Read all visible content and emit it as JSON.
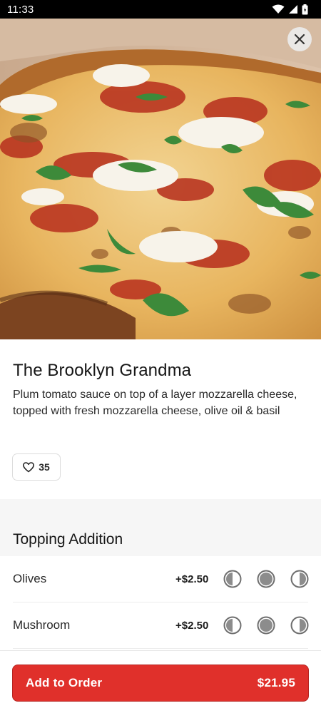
{
  "status_bar": {
    "time": "11:33",
    "icons": [
      "wifi-icon",
      "signal-icon",
      "battery-icon"
    ]
  },
  "hero": {
    "image": "pizza-photo",
    "close_icon": "close-icon"
  },
  "item": {
    "title": "The Brooklyn Grandma",
    "description": "Plum tomato sauce on top of a layer mozzarella cheese, topped with fresh mozzarella cheese, olive oil & basil",
    "likes": "35",
    "like_icon": "heart-icon"
  },
  "section": {
    "title": "Topping Addition"
  },
  "options": [
    {
      "name": "Olives",
      "price": "+$2.50",
      "portions": [
        "left-half",
        "whole",
        "right-half"
      ]
    },
    {
      "name": "Mushroom",
      "price": "+$2.50",
      "portions": [
        "left-half",
        "whole",
        "right-half"
      ]
    }
  ],
  "order_button": {
    "label": "Add to Order",
    "price": "$21.95"
  },
  "colors": {
    "accent": "#e0302b",
    "status_bar": "#000000",
    "section_bg": "#f6f6f6"
  }
}
